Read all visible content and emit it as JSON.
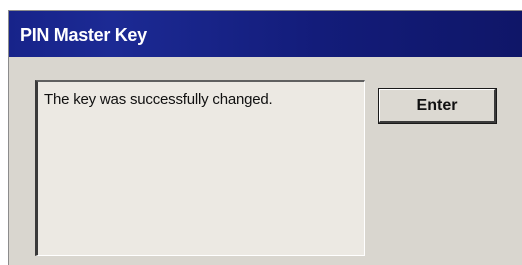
{
  "window": {
    "title": "PIN Master Key"
  },
  "dialog": {
    "message": "The key was successfully changed.",
    "enter_label": "Enter"
  }
}
